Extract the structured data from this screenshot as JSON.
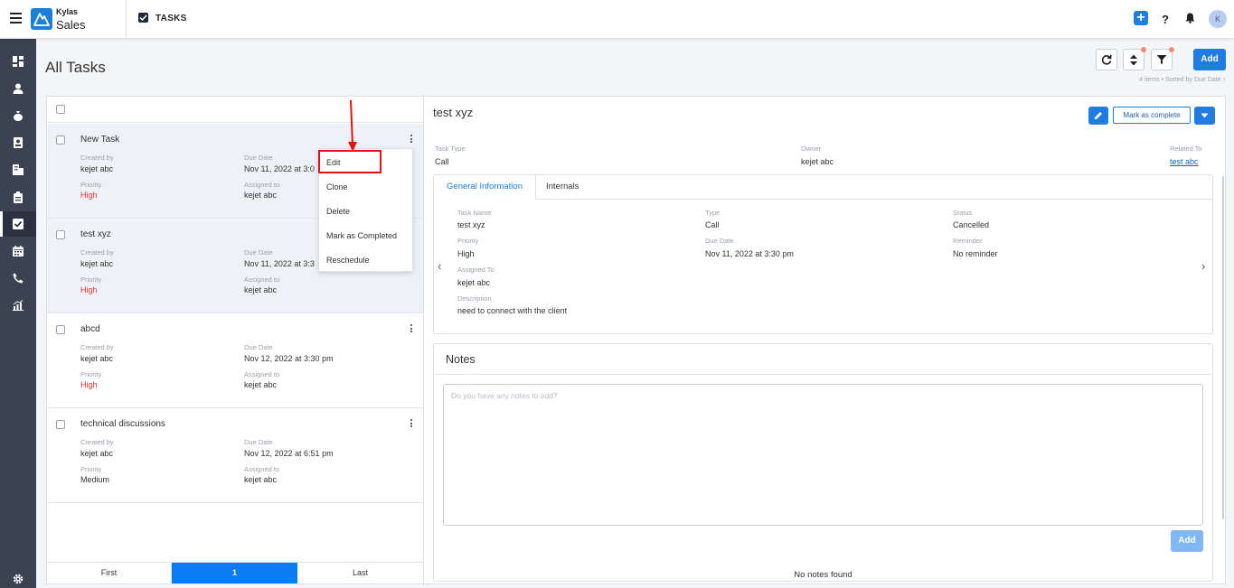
{
  "app": {
    "brand_top": "Kylas",
    "brand_bottom": "Sales",
    "module": "TASKS",
    "avatar_initial": "K"
  },
  "page": {
    "title": "All Tasks",
    "add_label": "Add",
    "sort_info": "4 items • Sorted by Due Date ↑"
  },
  "sidebar": {
    "items": [
      "dashboard-icon",
      "contacts-icon",
      "deals-icon",
      "leads-icon",
      "companies-icon",
      "products-icon",
      "tasks-icon",
      "calendar-icon",
      "calls-icon",
      "reports-icon"
    ],
    "footer": "settings-icon"
  },
  "labels": {
    "created_by": "Created by",
    "due_date": "Due Date",
    "priority": "Priority",
    "assigned_to": "Assigned to"
  },
  "tasks": [
    {
      "title": "New Task",
      "created_by": "kejet abc",
      "due_date": "Nov 11, 2022 at 3:0",
      "priority": "High",
      "assigned_to": "kejet abc"
    },
    {
      "title": "test xyz",
      "created_by": "kejet abc",
      "due_date": "Nov 11, 2022 at 3:3",
      "priority": "High",
      "assigned_to": "kejet abc"
    },
    {
      "title": "abcd",
      "created_by": "kejet abc",
      "due_date": "Nov 12, 2022 at 3:30 pm",
      "priority": "High",
      "assigned_to": "kejet abc"
    },
    {
      "title": "technical discussions",
      "created_by": "kejet abc",
      "due_date": "Nov 12, 2022 at 6:51 pm",
      "priority": "Medium",
      "assigned_to": "kejet abc"
    }
  ],
  "menu": {
    "items": [
      "Edit",
      "Clone",
      "Delete",
      "Mark as Completed",
      "Reschedule"
    ]
  },
  "pager": {
    "first": "First",
    "current": "1",
    "last": "Last"
  },
  "detail": {
    "title": "test xyz",
    "mark_complete": "Mark as complete",
    "task_type_label": "Task Type",
    "task_type": "Call",
    "owner_label": "Owner",
    "owner": "kejet abc",
    "related_label": "Related To",
    "related": "test abc",
    "tabs": [
      "General Information",
      "Internals"
    ],
    "fields": {
      "task_name_label": "Task Name",
      "task_name": "test xyz",
      "type_label": "Type",
      "type": "Call",
      "status_label": "Status",
      "status": "Cancelled",
      "priority_label": "Priority",
      "priority": "High",
      "due_date_label": "Due Date",
      "due_date": "Nov 11, 2022 at 3:30 pm",
      "reminder_label": "Reminder",
      "reminder": "No reminder",
      "assigned_label": "Assigned To",
      "assigned": "kejet abc",
      "description_label": "Description",
      "description": "need to connect with the client"
    }
  },
  "notes": {
    "title": "Notes",
    "placeholder": "Do you have any notes to add?",
    "add_label": "Add",
    "empty": "No notes found"
  },
  "colors": {
    "primary": "#1f7ce0",
    "sidebar": "#3b4252",
    "priority_high": "#e0302c",
    "highlight": "#e4130f"
  }
}
